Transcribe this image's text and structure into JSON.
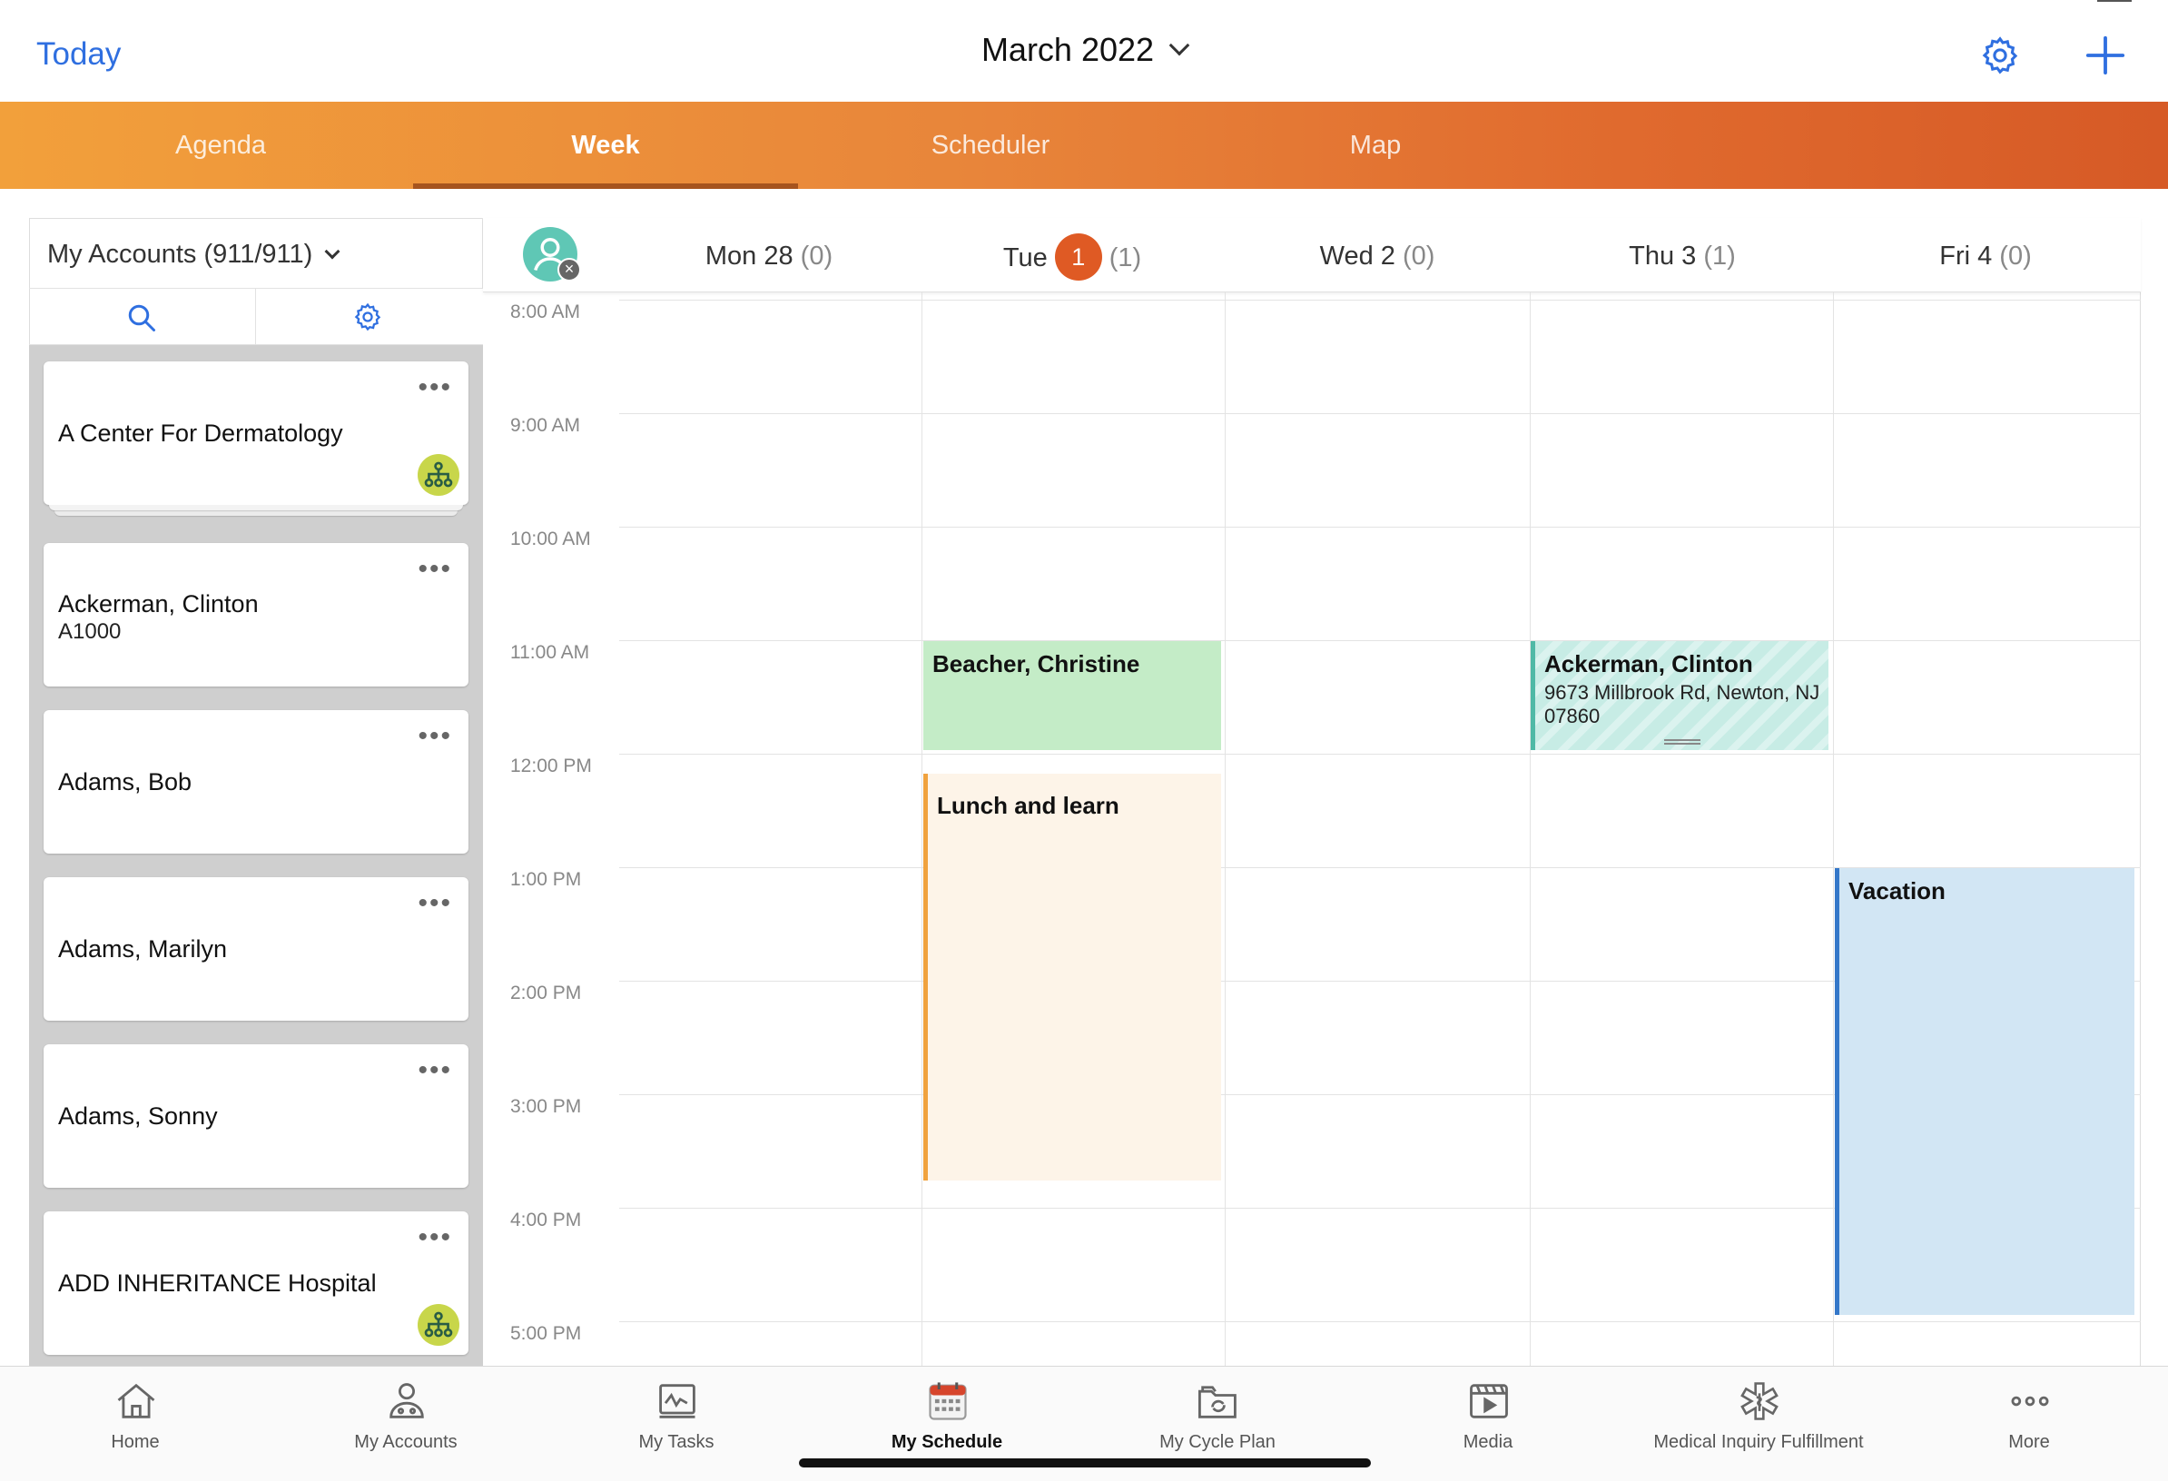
{
  "header": {
    "today_label": "Today",
    "month_title": "March 2022"
  },
  "tabs": [
    {
      "label": "Agenda",
      "active": false
    },
    {
      "label": "Week",
      "active": true
    },
    {
      "label": "Scheduler",
      "active": false
    },
    {
      "label": "Map",
      "active": false
    }
  ],
  "accounts": {
    "filter_label": "My Accounts (911/911)",
    "items": [
      {
        "name": "A Center For Dermatology",
        "sub": "",
        "badge": true
      },
      {
        "name": "Ackerman, Clinton",
        "sub": "A1000",
        "badge": false
      },
      {
        "name": "Adams, Bob",
        "sub": "",
        "badge": false
      },
      {
        "name": "Adams, Marilyn",
        "sub": "",
        "badge": false
      },
      {
        "name": "Adams, Sonny",
        "sub": "",
        "badge": false
      },
      {
        "name": "ADD INHERITANCE Hospital",
        "sub": "",
        "badge": true
      }
    ]
  },
  "week": {
    "days": [
      {
        "label": "Mon 28",
        "count": "(0)"
      },
      {
        "label": "Tue",
        "date_badge": "1",
        "count": "(1)"
      },
      {
        "label": "Wed 2",
        "count": "(0)"
      },
      {
        "label": "Thu 3",
        "count": "(1)"
      },
      {
        "label": "Fri 4",
        "count": "(0)"
      }
    ],
    "hours": [
      "8:00 AM",
      "9:00 AM",
      "10:00 AM",
      "11:00 AM",
      "12:00 PM",
      "1:00 PM",
      "2:00 PM",
      "3:00 PM",
      "4:00 PM",
      "5:00 PM"
    ],
    "events": {
      "beacher": {
        "title": "Beacher, Christine"
      },
      "lunch": {
        "title": "Lunch and learn"
      },
      "ackerman": {
        "title": "Ackerman, Clinton",
        "address": "9673 Millbrook Rd, Newton, NJ 07860"
      },
      "vacation": {
        "title": "Vacation"
      }
    }
  },
  "nav": [
    {
      "label": "Home",
      "icon": "home-icon"
    },
    {
      "label": "My Accounts",
      "icon": "accounts-icon"
    },
    {
      "label": "My Tasks",
      "icon": "tasks-icon"
    },
    {
      "label": "My Schedule",
      "icon": "calendar-icon",
      "active": true
    },
    {
      "label": "My Cycle Plan",
      "icon": "cycle-plan-icon"
    },
    {
      "label": "Media",
      "icon": "media-icon"
    },
    {
      "label": "Medical Inquiry Fulfillment",
      "icon": "medical-icon"
    },
    {
      "label": "More",
      "icon": "more-icon"
    }
  ],
  "colors": {
    "accent_blue": "#2f6fe0",
    "tab_orange": "#e8853a",
    "today_badge": "#df5a24",
    "event_green": "#c4ecc7",
    "event_lunch_bar": "#f0a23e",
    "event_teal_bar": "#4fb9a6",
    "event_vacation": "#d2e6f4",
    "event_vacation_bar": "#3477c9",
    "account_badge": "#c8d64a"
  }
}
